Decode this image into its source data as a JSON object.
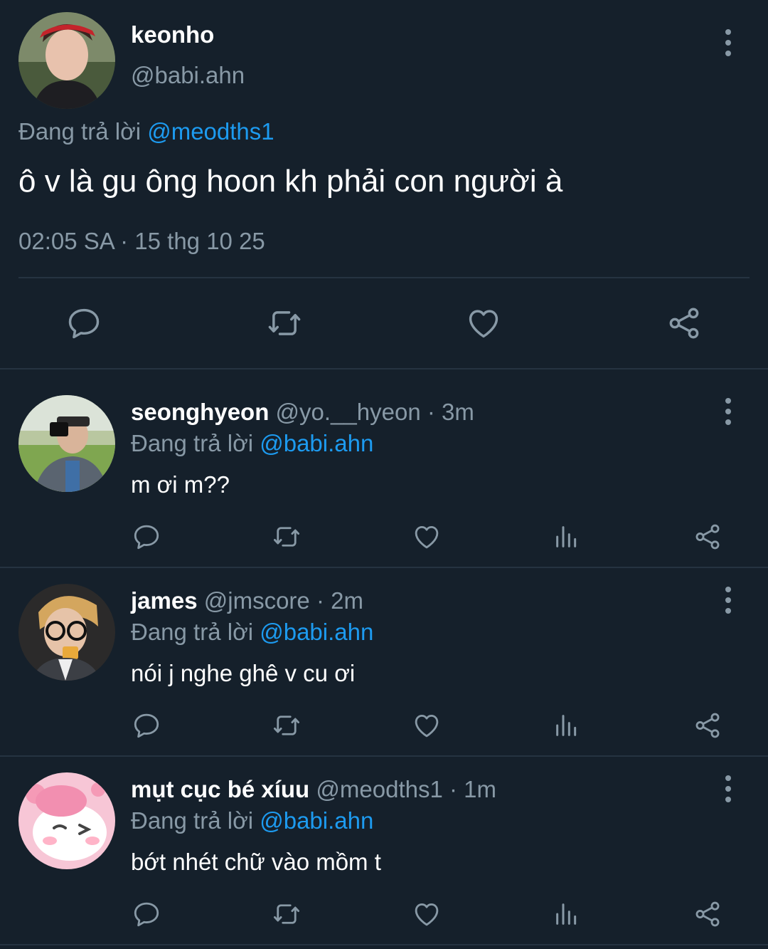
{
  "main_tweet": {
    "display_name": "keonho",
    "handle": "@babi.ahn",
    "reply_prefix": "Đang trả lời",
    "reply_to": "@meodths1",
    "text": "ô v là gu ông hoon kh phải con người à",
    "timestamp": "02:05 SA · 15 thg 10 25"
  },
  "replies": [
    {
      "display_name": "seonghyeon",
      "handle": "@yo.__hyeon",
      "time": "· 3m",
      "reply_prefix": "Đang trả lời",
      "reply_to": "@babi.ahn",
      "text": "m ơi m??"
    },
    {
      "display_name": "james",
      "handle": "@jmscore",
      "time": "· 2m",
      "reply_prefix": "Đang trả lời",
      "reply_to": "@babi.ahn",
      "text": "nói j nghe ghê v cu ơi"
    },
    {
      "display_name": "mụt cục bé xíuu",
      "handle": "@meodths1",
      "time": "· 1m",
      "reply_prefix": "Đang trả lời",
      "reply_to": "@babi.ahn",
      "text": "bớt nhét chữ vào mồm t"
    }
  ],
  "icons": {
    "reply": "reply-icon",
    "retweet": "retweet-icon",
    "like": "heart-icon",
    "views": "views-icon",
    "share": "share-icon",
    "more": "more-icon"
  },
  "colors": {
    "background": "#15202b",
    "text": "#ffffff",
    "muted": "#8899a6",
    "link": "#1d9bf0",
    "divider": "#253341"
  }
}
